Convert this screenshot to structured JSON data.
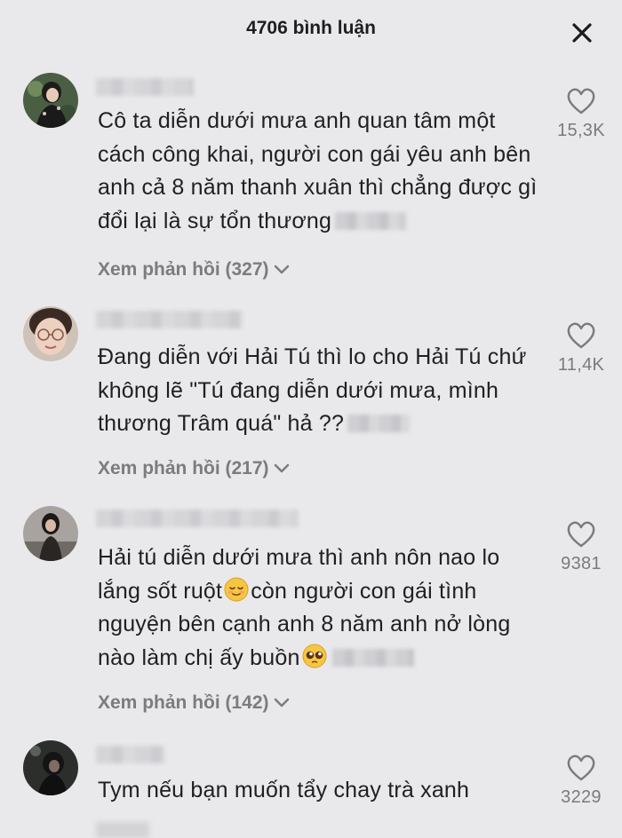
{
  "header": {
    "title": "4706 bình luận",
    "close_icon": "close-icon"
  },
  "comments": [
    {
      "text": "Cô ta diễn dưới mưa anh quan tâm một cách công khai, người con gái yêu anh bên anh cả 8 năm thanh xuân thì chẳng được gì đổi lại là sự tổn thương",
      "replies_label": "Xem phản hồi (327)",
      "like_count": "15,3K"
    },
    {
      "text": "Đang diễn với Hải Tú thì lo cho Hải Tú chứ không lẽ \"Tú đang diễn dưới mưa, mình thương Trâm quá\" hả ??",
      "replies_label": "Xem phản hồi (217)",
      "like_count": "11,4K"
    },
    {
      "text_part1": "Hải tú diễn dưới mưa thì anh nôn nao lo lắng sốt ruột",
      "text_part2": "còn người con gái tình nguyện bên cạnh anh 8 năm anh nở lòng nào làm chị ấy buồn",
      "emoji_1": "relieved-face-emoji",
      "emoji_2": "pleading-face-emoji",
      "replies_label": "Xem phản hồi (142)",
      "like_count": "9381"
    },
    {
      "text": "Tym nếu bạn muốn tẩy chay trà xanh",
      "like_count": "3229"
    }
  ],
  "colors": {
    "background": "#e9e9eb",
    "text": "#202023",
    "muted": "#7b7b80"
  }
}
